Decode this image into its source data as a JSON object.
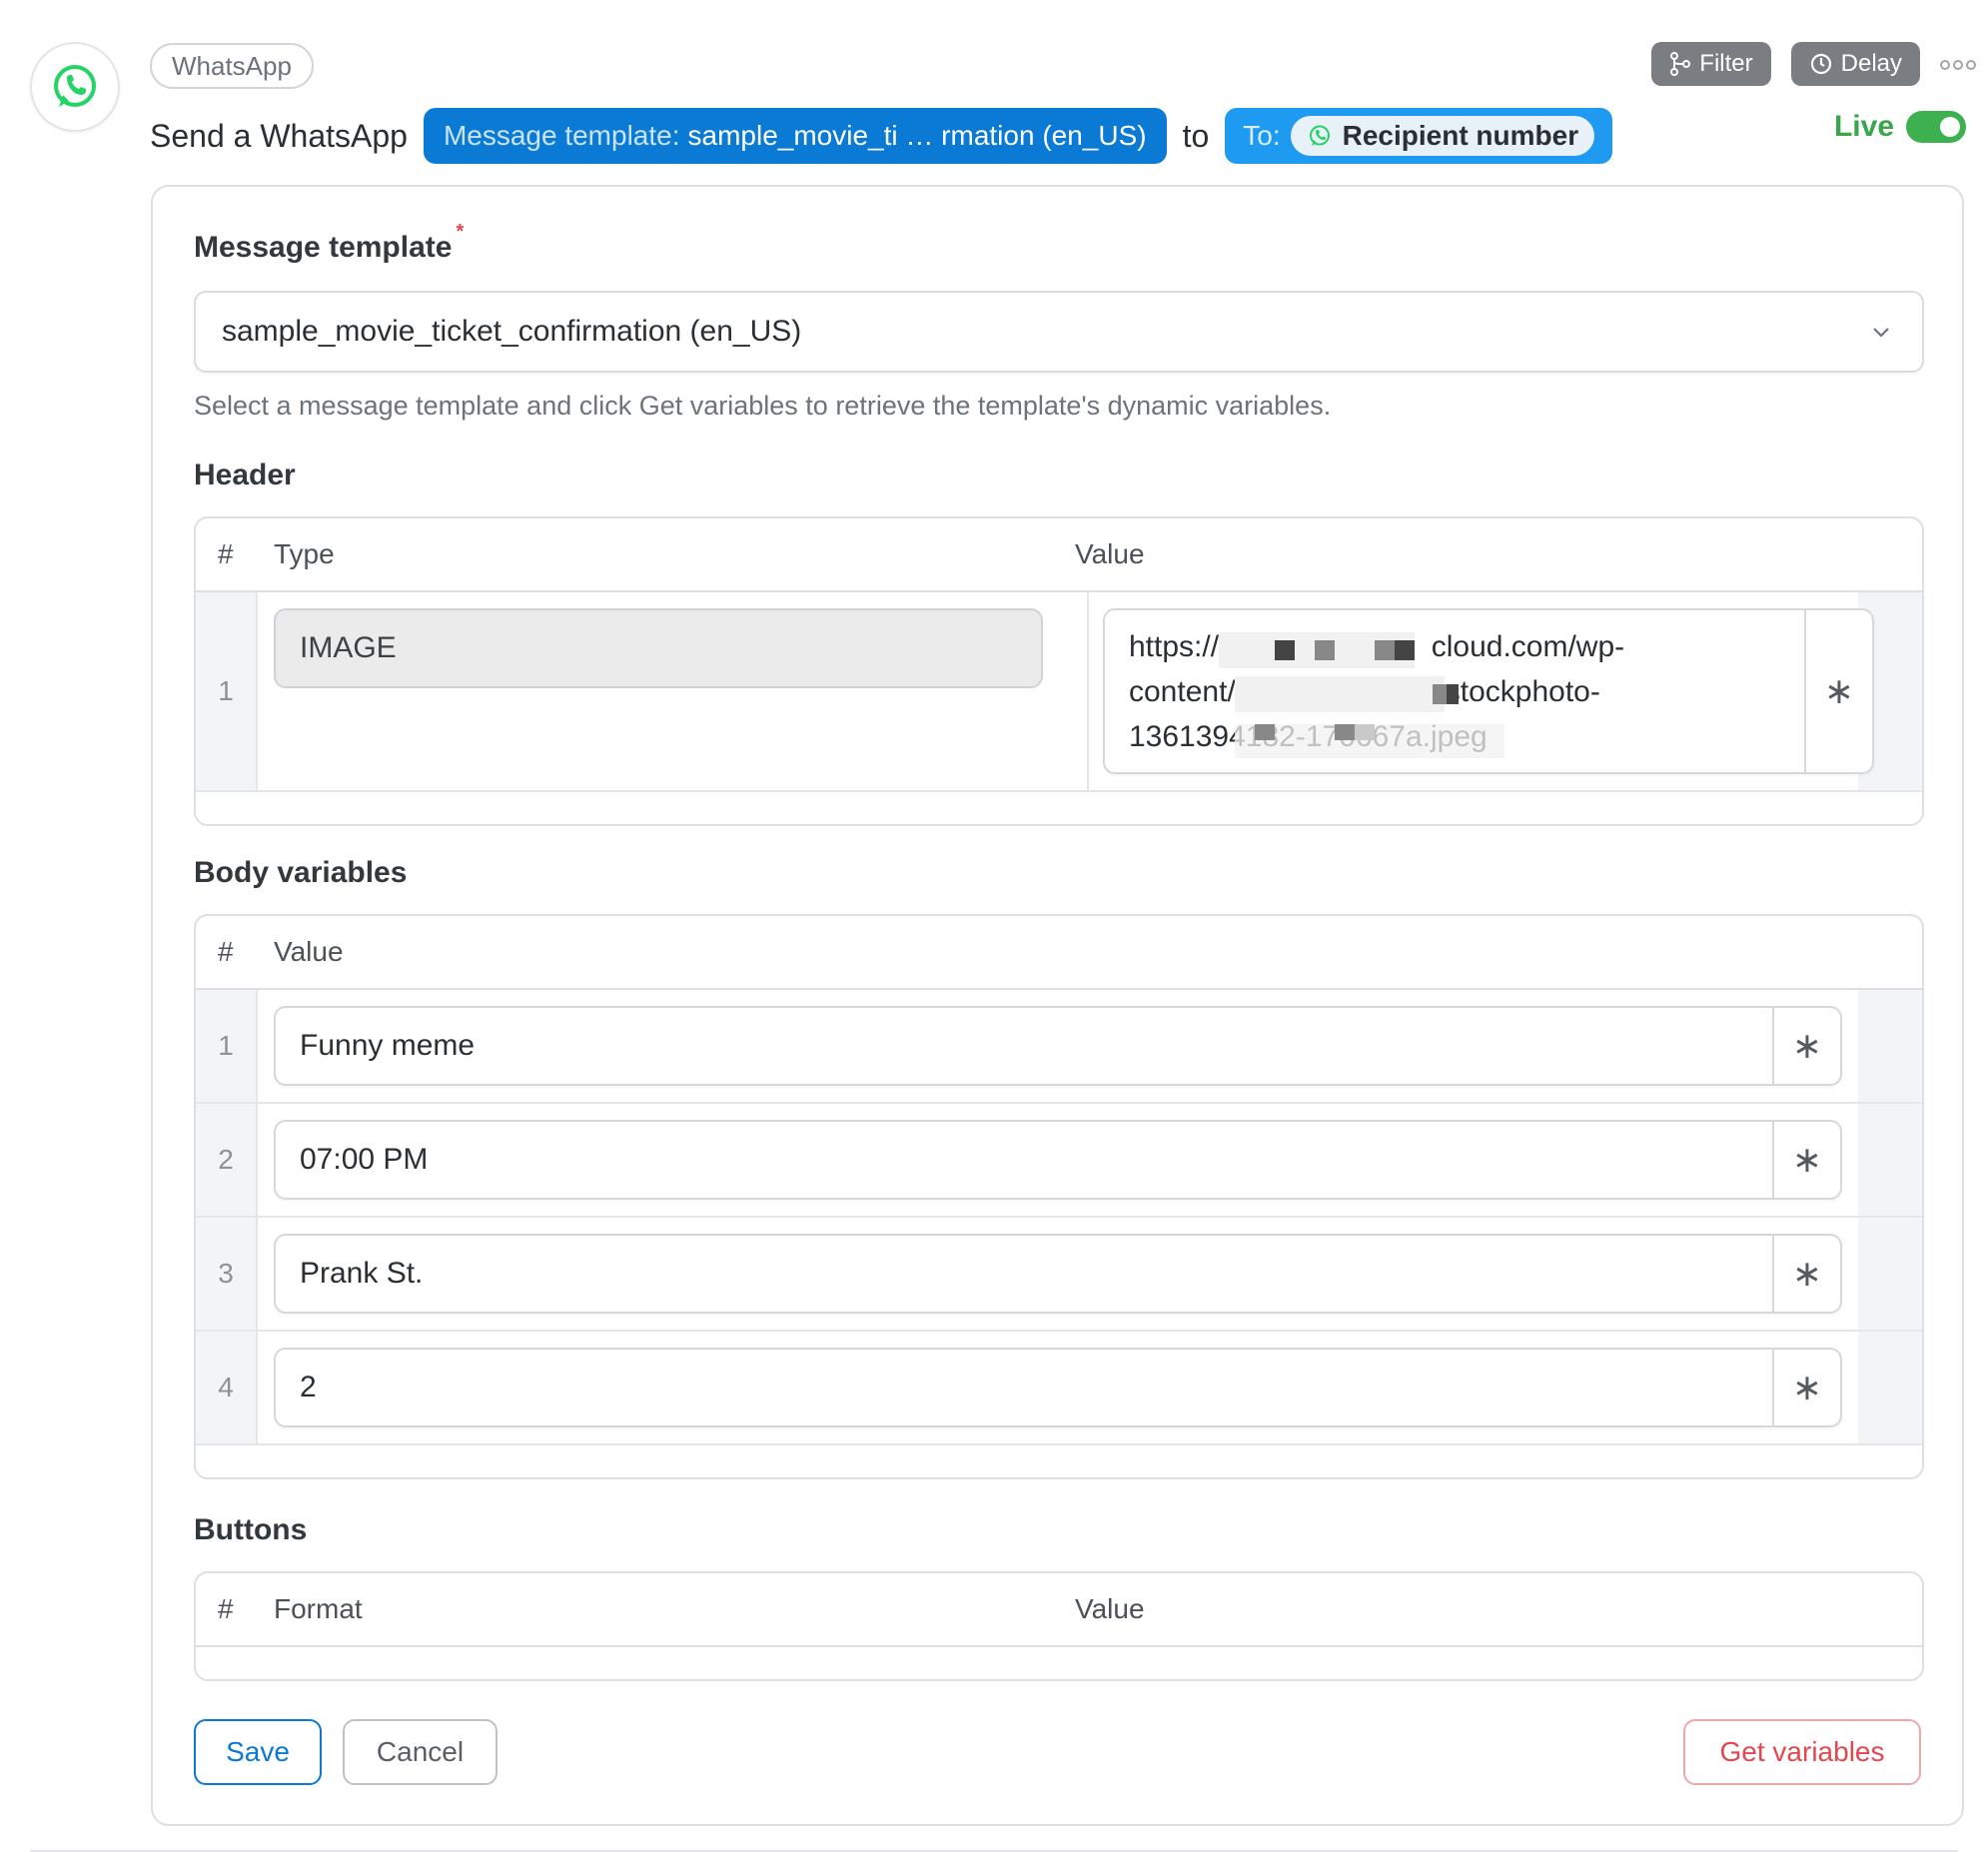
{
  "app": {
    "name": "WhatsApp",
    "brand_color": "#25D366"
  },
  "toolbar": {
    "filter_label": "Filter",
    "delay_label": "Delay",
    "more_icon": "more-dots-icon"
  },
  "summary": {
    "prefix": "Send a WhatsApp",
    "template_key": "Message template:",
    "template_value": "sample_movie_ti … rmation (en_US)",
    "connector": "to",
    "to_label": "To:",
    "recipient": "Recipient number"
  },
  "status": {
    "label": "Live",
    "enabled": true,
    "color": "#3db14f"
  },
  "message_template": {
    "label": "Message template",
    "required_mark": "*",
    "selected_value": "sample_movie_ticket_confirmation (en_US)",
    "help_text": "Select a message template and click Get variables to retrieve the template's dynamic variables."
  },
  "header_section": {
    "title": "Header",
    "columns": [
      "#",
      "Type",
      "Value"
    ],
    "rows": [
      {
        "index": "1",
        "type": "IMAGE",
        "value_lines": [
          "https://a",
          "cloud.com/wp-",
          "content/",
          "stockphoto-",
          "1361394182-170667a.jpeg"
        ]
      }
    ],
    "star_symbol": "∗"
  },
  "body_section": {
    "title": "Body variables",
    "columns": [
      "#",
      "Value"
    ],
    "rows": [
      {
        "index": "1",
        "value": "Funny meme"
      },
      {
        "index": "2",
        "value": "07:00 PM"
      },
      {
        "index": "3",
        "value": "Prank St."
      },
      {
        "index": "4",
        "value": "2"
      }
    ]
  },
  "buttons_section": {
    "title": "Buttons",
    "columns": [
      "#",
      "Format",
      "Value"
    ]
  },
  "actions": {
    "save_label": "Save",
    "cancel_label": "Cancel",
    "get_variables_label": "Get variables"
  },
  "colors": {
    "primary": "#0b7ad4",
    "primary_light": "#1f9af1",
    "danger": "#e4474f",
    "pill_gray": "#7a7d82"
  }
}
